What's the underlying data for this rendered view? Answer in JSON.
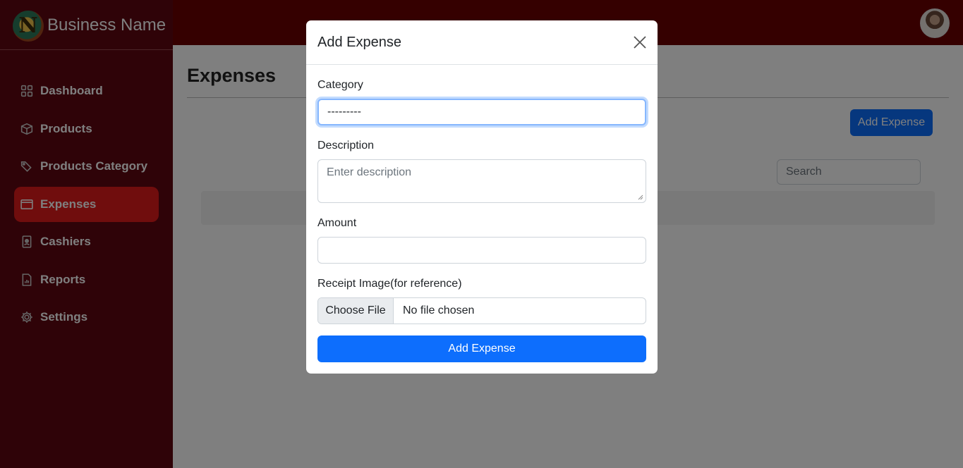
{
  "brand": {
    "name": "Business Name",
    "logo_letter": "N"
  },
  "sidebar": {
    "items": [
      {
        "label": "Dashboard",
        "icon": "grid-icon"
      },
      {
        "label": "Products",
        "icon": "box-icon"
      },
      {
        "label": "Products Category",
        "icon": "tags-icon"
      },
      {
        "label": "Expenses",
        "icon": "wallet-icon",
        "active": true
      },
      {
        "label": "Cashiers",
        "icon": "person-badge-icon"
      },
      {
        "label": "Reports",
        "icon": "file-chart-icon"
      },
      {
        "label": "Settings",
        "icon": "gear-icon"
      }
    ]
  },
  "main": {
    "title": "Expenses",
    "add_button": "Add Expense",
    "search_placeholder": "Search"
  },
  "modal": {
    "title": "Add Expense",
    "category_label": "Category",
    "category_value": "---------",
    "description_label": "Description",
    "description_placeholder": "Enter description",
    "amount_label": "Amount",
    "amount_value": "",
    "receipt_label": "Receipt Image(for reference)",
    "choose_file": "Choose File",
    "file_status": "No file chosen",
    "submit": "Add Expense"
  },
  "colors": {
    "sidebar_bg": "#5e0711",
    "header_bg": "#6a0000",
    "active_item": "#e01b1b",
    "primary": "#0d6efd"
  }
}
